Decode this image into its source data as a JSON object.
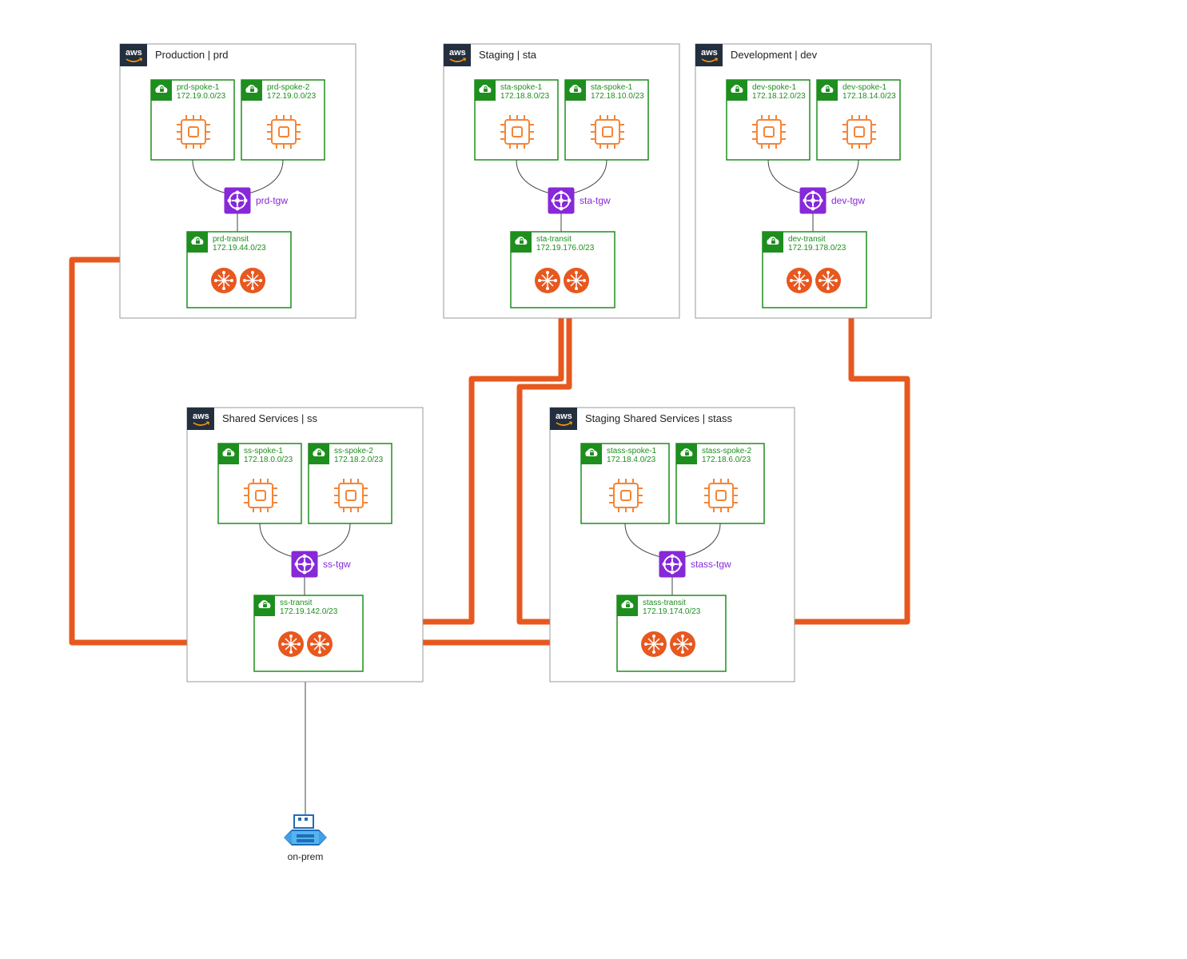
{
  "diagram": {
    "accounts": {
      "prd": {
        "title": "Production | prd",
        "spokes": [
          {
            "name": "prd-spoke-1",
            "cidr": "172.19.0.0/23"
          },
          {
            "name": "prd-spoke-2",
            "cidr": "172.19.0.0/23"
          }
        ],
        "tgw": {
          "label": "prd-tgw"
        },
        "transit": {
          "name": "prd-transit",
          "cidr": "172.19.44.0/23"
        }
      },
      "sta": {
        "title": "Staging | sta",
        "spokes": [
          {
            "name": "sta-spoke-1",
            "cidr": "172.18.8.0/23"
          },
          {
            "name": "sta-spoke-1",
            "cidr": "172.18.10.0/23"
          }
        ],
        "tgw": {
          "label": "sta-tgw"
        },
        "transit": {
          "name": "sta-transit",
          "cidr": "172.19.176.0/23"
        }
      },
      "dev": {
        "title": "Development | dev",
        "spokes": [
          {
            "name": "dev-spoke-1",
            "cidr": "172.18.12.0/23"
          },
          {
            "name": "dev-spoke-1",
            "cidr": "172.18.14.0/23"
          }
        ],
        "tgw": {
          "label": "dev-tgw"
        },
        "transit": {
          "name": "dev-transit",
          "cidr": "172.19.178.0/23"
        }
      },
      "ss": {
        "title": "Shared Services | ss",
        "spokes": [
          {
            "name": "ss-spoke-1",
            "cidr": "172.18.0.0/23"
          },
          {
            "name": "ss-spoke-2",
            "cidr": "172.18.2.0/23"
          }
        ],
        "tgw": {
          "label": "ss-tgw"
        },
        "transit": {
          "name": "ss-transit",
          "cidr": "172.19.142.0/23"
        }
      },
      "stass": {
        "title": "Staging Shared Services | stass",
        "spokes": [
          {
            "name": "stass-spoke-1",
            "cidr": "172.18.4.0/23"
          },
          {
            "name": "stass-spoke-2",
            "cidr": "172.18.6.0/23"
          }
        ],
        "tgw": {
          "label": "stass-tgw"
        },
        "transit": {
          "name": "stass-transit",
          "cidr": "172.19.174.0/23"
        }
      }
    },
    "onprem": {
      "label": "on-prem"
    },
    "connections": {
      "transit_peering": [
        "prd->ss",
        "sta->ss",
        "sta->stass",
        "dev->stass",
        "ss->stass"
      ],
      "onprem_link": "ss-transit -> on-prem"
    },
    "colors": {
      "account_border": "#999999",
      "vpc_border": "#1e8e1e",
      "tgw": "#8728d9",
      "transit_node": "#e7581f",
      "peering_line": "#e7581f",
      "compute_icon": "#f58536",
      "aws_badge": "#232f3e"
    }
  }
}
